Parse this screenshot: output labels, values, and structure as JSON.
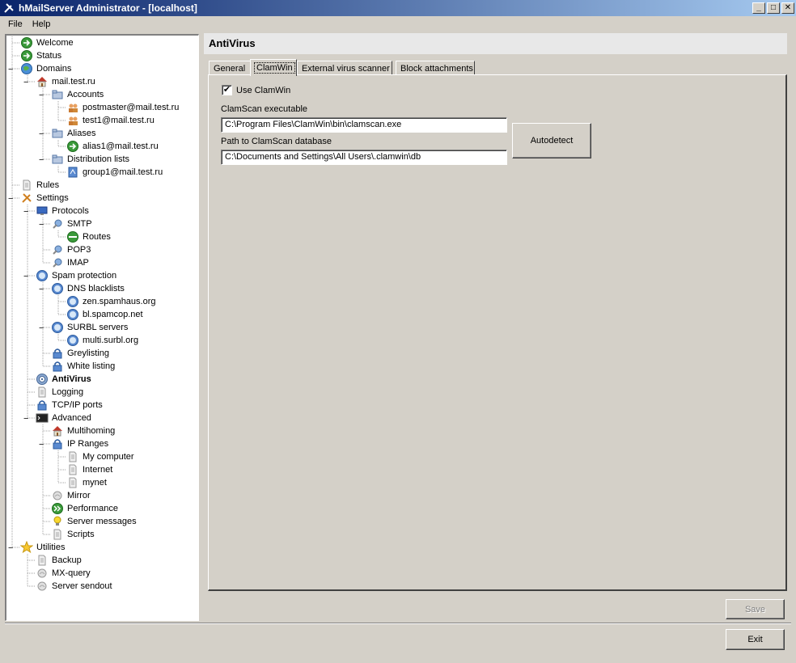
{
  "window": {
    "title": "hMailServer Administrator - [localhost]"
  },
  "menu": [
    "File",
    "Help"
  ],
  "tree": [
    {
      "label": "Welcome",
      "icon": "arrow-icon",
      "level": 1
    },
    {
      "label": "Status",
      "icon": "arrow-icon",
      "level": 1
    },
    {
      "label": "Domains",
      "icon": "globe-icon",
      "level": 1,
      "expander": "-"
    },
    {
      "label": "mail.test.ru",
      "icon": "house-icon",
      "level": 2,
      "expander": "-"
    },
    {
      "label": "Accounts",
      "icon": "folder-icon",
      "level": 3,
      "expander": "-"
    },
    {
      "label": "postmaster@mail.test.ru",
      "icon": "users-icon",
      "level": 4
    },
    {
      "label": "test1@mail.test.ru",
      "icon": "users-icon",
      "level": 4
    },
    {
      "label": "Aliases",
      "icon": "folder-icon",
      "level": 3,
      "expander": "-"
    },
    {
      "label": "alias1@mail.test.ru",
      "icon": "arrow-icon",
      "level": 4
    },
    {
      "label": "Distribution lists",
      "icon": "folder-icon",
      "level": 3,
      "expander": "-"
    },
    {
      "label": "group1@mail.test.ru",
      "icon": "list-icon",
      "level": 4
    },
    {
      "label": "Rules",
      "icon": "doc-icon",
      "level": 1
    },
    {
      "label": "Settings",
      "icon": "tools-icon",
      "level": 1,
      "expander": "-"
    },
    {
      "label": "Protocols",
      "icon": "monitor-icon",
      "level": 2,
      "expander": "-"
    },
    {
      "label": "SMTP",
      "icon": "protocol-icon",
      "level": 3,
      "expander": "-"
    },
    {
      "label": "Routes",
      "icon": "route-icon",
      "level": 4
    },
    {
      "label": "POP3",
      "icon": "protocol-icon",
      "level": 3
    },
    {
      "label": "IMAP",
      "icon": "protocol-icon",
      "level": 3
    },
    {
      "label": "Spam protection",
      "icon": "shield-icon",
      "level": 2,
      "expander": "-"
    },
    {
      "label": "DNS blacklists",
      "icon": "shield-icon",
      "level": 3,
      "expander": "-"
    },
    {
      "label": "zen.spamhaus.org",
      "icon": "shield-icon",
      "level": 4
    },
    {
      "label": "bl.spamcop.net",
      "icon": "shield-icon",
      "level": 4
    },
    {
      "label": "SURBL servers",
      "icon": "shield-icon",
      "level": 3,
      "expander": "-"
    },
    {
      "label": "multi.surbl.org",
      "icon": "shield-icon",
      "level": 4
    },
    {
      "label": "Greylisting",
      "icon": "lock-icon",
      "level": 3
    },
    {
      "label": "White listing",
      "icon": "lock-icon",
      "level": 3
    },
    {
      "label": "AntiVirus",
      "icon": "target-icon",
      "level": 2,
      "bold": true
    },
    {
      "label": "Logging",
      "icon": "doc-icon",
      "level": 2
    },
    {
      "label": "TCP/IP ports",
      "icon": "lock-icon",
      "level": 2
    },
    {
      "label": "Advanced",
      "icon": "console-icon",
      "level": 2,
      "expander": "-"
    },
    {
      "label": "Multihoming",
      "icon": "house-icon",
      "level": 3
    },
    {
      "label": "IP Ranges",
      "icon": "lock-icon",
      "level": 3,
      "expander": "-"
    },
    {
      "label": "My computer",
      "icon": "doc-icon",
      "level": 4
    },
    {
      "label": "Internet",
      "icon": "doc-icon",
      "level": 4
    },
    {
      "label": "mynet",
      "icon": "doc-icon",
      "level": 4
    },
    {
      "label": "Mirror",
      "icon": "mirror-icon",
      "level": 3
    },
    {
      "label": "Performance",
      "icon": "forward-icon",
      "level": 3
    },
    {
      "label": "Server messages",
      "icon": "bulb-icon",
      "level": 3
    },
    {
      "label": "Scripts",
      "icon": "doc-icon",
      "level": 3
    },
    {
      "label": "Utilities",
      "icon": "star-icon",
      "level": 1,
      "expander": "-"
    },
    {
      "label": "Backup",
      "icon": "doc-icon",
      "level": 2
    },
    {
      "label": "MX-query",
      "icon": "mirror-icon",
      "level": 2
    },
    {
      "label": "Server sendout",
      "icon": "mirror-icon",
      "level": 2
    }
  ],
  "content": {
    "header": "AntiVirus",
    "tabs": [
      "General",
      "ClamWin",
      "External virus scanner",
      "Block attachments"
    ],
    "active_tab": "ClamWin",
    "use_clamwin_label": "Use ClamWin",
    "use_clamwin_checked": true,
    "executable_label": "ClamScan executable",
    "executable_value": "C:\\Program Files\\ClamWin\\bin\\clamscan.exe",
    "database_label": "Path to ClamScan database",
    "database_value": "C:\\Documents and Settings\\All Users\\.clamwin\\db",
    "autodetect_label": "Autodetect",
    "save_label": "Save",
    "exit_label": "Exit"
  }
}
